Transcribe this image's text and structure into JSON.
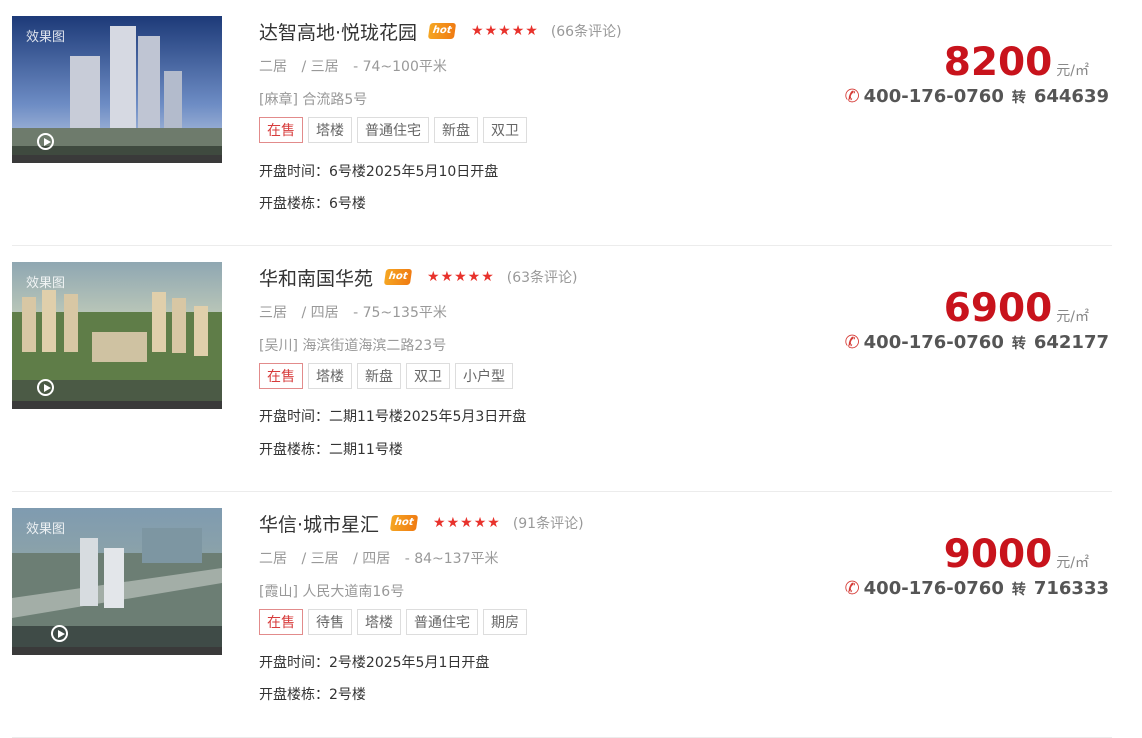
{
  "listings": [
    {
      "image_label": "效果图",
      "title": "达智高地·悦珑花园",
      "hot_label": "hot",
      "stars": "★★★★★",
      "reviews": "(66条评论)",
      "rooms": [
        "二居",
        "/ 三居"
      ],
      "area": "- 74~100平米",
      "address": "[麻章] 合流路5号",
      "tags": [
        "在售",
        "塔楼",
        "普通住宅",
        "新盘",
        "双卫"
      ],
      "open_time": "开盘时间：6号楼2025年5月10日开盘",
      "open_building": "开盘楼栋：6号楼",
      "price": "8200",
      "price_unit": "元/㎡",
      "phone": "400-176-0760",
      "phone_transfer": "转",
      "phone_ext": "644639"
    },
    {
      "image_label": "效果图",
      "title": "华和南国华苑",
      "hot_label": "hot",
      "stars": "★★★★★",
      "reviews": "(63条评论)",
      "rooms": [
        "三居",
        "/ 四居"
      ],
      "area": "- 75~135平米",
      "address": "[吴川] 海滨街道海滨二路23号",
      "tags": [
        "在售",
        "塔楼",
        "新盘",
        "双卫",
        "小户型"
      ],
      "open_time": "开盘时间：二期11号楼2025年5月3日开盘",
      "open_building": "开盘楼栋：二期11号楼",
      "price": "6900",
      "price_unit": "元/㎡",
      "phone": "400-176-0760",
      "phone_transfer": "转",
      "phone_ext": "642177"
    },
    {
      "image_label": "效果图",
      "title": "华信·城市星汇",
      "hot_label": "hot",
      "stars": "★★★★★",
      "reviews": "(91条评论)",
      "rooms": [
        "二居",
        "/ 三居",
        "/ 四居"
      ],
      "area": "- 84~137平米",
      "address": "[霞山] 人民大道南16号",
      "tags": [
        "在售",
        "待售",
        "塔楼",
        "普通住宅",
        "期房"
      ],
      "open_time": "开盘时间：2号楼2025年5月1日开盘",
      "open_building": "开盘楼栋：2号楼",
      "price": "9000",
      "price_unit": "元/㎡",
      "phone": "400-176-0760",
      "phone_transfer": "转",
      "phone_ext": "716333"
    }
  ],
  "icons": {
    "phone": "phone-icon",
    "play": "play-icon"
  },
  "colors": {
    "price": "#c8131c",
    "star": "#e8322c",
    "on_sale": "#d73c3c",
    "hot": "#f5a623"
  }
}
